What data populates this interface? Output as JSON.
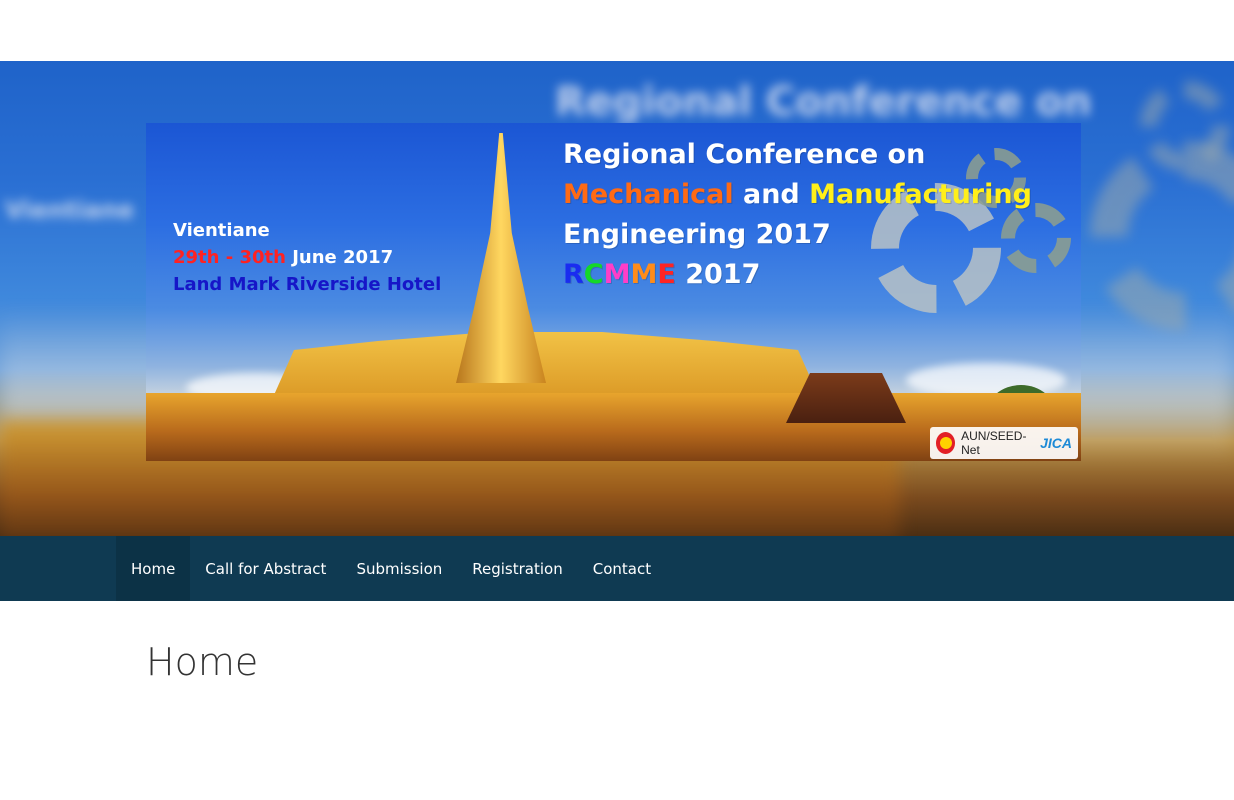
{
  "banner": {
    "title_line1": "Regional Conference on",
    "title_line2_a": "Mechanical",
    "title_line2_b": " and ",
    "title_line2_c": "Manufacturing",
    "title_line3": "Engineering 2017",
    "acronym_r": "R",
    "acronym_c": "C",
    "acronym_m1": "M",
    "acronym_m2": "M",
    "acronym_e": "E",
    "acronym_year": " 2017",
    "city": "Vientiane",
    "dates": "29th - 30th",
    "month_year": " June 2017",
    "venue": "Land Mark Riverside Hotel",
    "sponsor_text": "AUN/SEED-Net",
    "sponsor_jica": "JICA"
  },
  "nav": {
    "items": [
      {
        "label": "Home",
        "active": true
      },
      {
        "label": "Call for Abstract",
        "active": false
      },
      {
        "label": "Submission",
        "active": false
      },
      {
        "label": "Registration",
        "active": false
      },
      {
        "label": "Contact",
        "active": false
      }
    ]
  },
  "page": {
    "title": "Home"
  },
  "colors": {
    "nav_bg": "#0f3a52",
    "nav_active_bg": "#0c3246",
    "accent_orange": "#ff6a14",
    "accent_yellow": "#ffef1a"
  }
}
